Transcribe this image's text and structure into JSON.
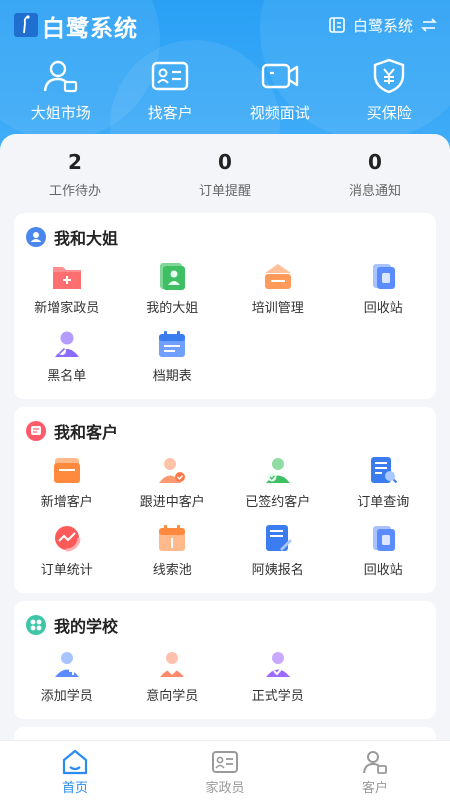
{
  "app": {
    "title": "白鹭系统",
    "switch_label": "白鹭系统"
  },
  "quick_actions": [
    {
      "label": "大姐市场",
      "icon": "person-badge-icon"
    },
    {
      "label": "找客户",
      "icon": "id-card-icon"
    },
    {
      "label": "视频面试",
      "icon": "video-camera-icon"
    },
    {
      "label": "买保险",
      "icon": "shield-yen-icon"
    }
  ],
  "stats": [
    {
      "value": "2",
      "label": "工作待办"
    },
    {
      "value": "0",
      "label": "订单提醒"
    },
    {
      "value": "0",
      "label": "消息通知"
    }
  ],
  "sections": [
    {
      "title": "我和大姐",
      "items": [
        {
          "label": "新增家政员",
          "color": "#ff7a7a"
        },
        {
          "label": "我的大姐",
          "color": "#3fbf63"
        },
        {
          "label": "培训管理",
          "color": "#ff9a5a"
        },
        {
          "label": "回收站",
          "color": "#5a8cff"
        },
        {
          "label": "黑名单",
          "color": "#8a6cff"
        },
        {
          "label": "档期表",
          "color": "#3b7cf0"
        }
      ]
    },
    {
      "title": "我和客户",
      "items": [
        {
          "label": "新增客户",
          "color": "#ff8a3d"
        },
        {
          "label": "跟进中客户",
          "color": "#ff9a70"
        },
        {
          "label": "已签约客户",
          "color": "#3fbf63"
        },
        {
          "label": "订单查询",
          "color": "#3b7cf0"
        },
        {
          "label": "订单统计",
          "color": "#ff5a5a"
        },
        {
          "label": "线索池",
          "color": "#ff8a3d"
        },
        {
          "label": "阿姨报名",
          "color": "#3b7cf0"
        },
        {
          "label": "回收站",
          "color": "#5a8cff"
        }
      ]
    },
    {
      "title": "我的学校",
      "items": [
        {
          "label": "添加学员",
          "color": "#5a8cff"
        },
        {
          "label": "意向学员",
          "color": "#ff8a6a"
        },
        {
          "label": "正式学员",
          "color": "#9a6cff"
        }
      ]
    }
  ],
  "tabs": [
    {
      "label": "首页",
      "active": true
    },
    {
      "label": "家政员",
      "active": false
    },
    {
      "label": "客户",
      "active": false
    }
  ],
  "colors": {
    "primary": "#2aa0f5",
    "tab_active": "#2a8cf0",
    "tab_inactive": "#999999"
  }
}
